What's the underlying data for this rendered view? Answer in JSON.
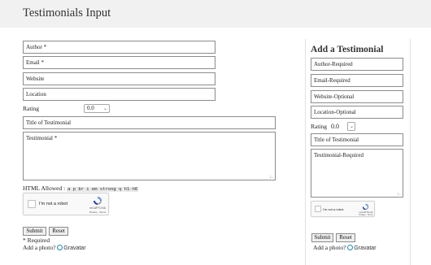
{
  "page": {
    "title": "Testimonials Input"
  },
  "form": {
    "author_placeholder": "Author *",
    "email_placeholder": "Email *",
    "website_placeholder": "Website",
    "location_placeholder": "Location",
    "rating_label": "Rating",
    "rating_value": "0.0",
    "title_placeholder": "Title of Testimonial",
    "testimonial_placeholder": "Testimonial *",
    "html_allowed_label": "HTML Allowed :",
    "html_allowed_tags": "a p br i em strong q h1-h6",
    "recaptcha_text": "I'm not a robot",
    "recaptcha_brand": "reCAPTCHA",
    "recaptcha_links": "Privacy - Terms",
    "submit_label": "Submit",
    "reset_label": "Reset",
    "required_note": "* Required",
    "add_photo_label": "Add a photo?",
    "gravatar_label": "Gravatar"
  },
  "sidebar": {
    "title": "Add a Testimonial",
    "author_placeholder": "Author-Required",
    "email_placeholder": "Email-Required",
    "website_placeholder": "Website-Optional",
    "location_placeholder": "Location-Optional",
    "rating_label": "Rating",
    "rating_value": "0.0",
    "title_placeholder": "Title of Testimonial",
    "testimonial_placeholder": "Testimonial-Required",
    "recaptcha_text": "I'm not a robot",
    "recaptcha_brand": "reCAPTCHA",
    "recaptcha_links": "Privacy - Terms",
    "submit_label": "Submit",
    "reset_label": "Reset",
    "add_photo_label": "Add a photo?",
    "gravatar_label": "Gravatar"
  },
  "colors": {
    "gravatar_blue": "#1e8cbe",
    "recaptcha_blue": "#4a90e2"
  },
  "icons": {
    "dropdown": "chevron-down-icon",
    "recaptcha": "recaptcha-logo-icon",
    "gravatar": "gravatar-icon",
    "resize": "resize-grip-icon"
  }
}
